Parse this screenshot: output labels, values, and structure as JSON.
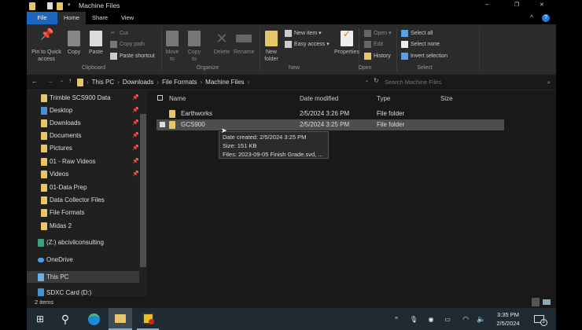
{
  "window": {
    "title": "Machine Files",
    "controls": {
      "minimize": "–",
      "maximize": "❐",
      "close": "✕"
    }
  },
  "tabs": [
    "File",
    "Home",
    "Share",
    "View"
  ],
  "ribbon": {
    "clipboard": {
      "label": "Clipboard",
      "pin": "Pin to Quick access",
      "copy": "Copy",
      "paste": "Paste",
      "cut": "Cut",
      "copy_path": "Copy path",
      "paste_shortcut": "Paste shortcut"
    },
    "organize": {
      "label": "Organize",
      "move_to": "Move to",
      "copy_to": "Copy to",
      "delete": "Delete",
      "rename": "Rename"
    },
    "new": {
      "label": "New",
      "new_folder": "New folder",
      "new_item": "New item ▾",
      "easy_access": "Easy access ▾"
    },
    "open": {
      "label": "Open",
      "properties": "Properties",
      "open": "Open ▾",
      "edit": "Edit",
      "history": "History"
    },
    "select": {
      "label": "Select",
      "select_all": "Select all",
      "select_none": "Select none",
      "invert": "Invert selection"
    }
  },
  "address": {
    "breadcrumb": [
      "This PC",
      "Downloads",
      "File Formats",
      "Machine Files"
    ],
    "search_placeholder": "Search Machine Files"
  },
  "nav": {
    "items": [
      {
        "label": "Trimble SCS900 Data",
        "pinned": true
      },
      {
        "label": "Desktop",
        "pinned": true
      },
      {
        "label": "Downloads",
        "pinned": true
      },
      {
        "label": "Documents",
        "pinned": true
      },
      {
        "label": "Pictures",
        "pinned": true
      },
      {
        "label": "01 - Raw Videos",
        "pinned": true
      },
      {
        "label": "Videos",
        "pinned": true
      },
      {
        "label": "01-Data Prep",
        "pinned": false
      },
      {
        "label": "Data Collector Files",
        "pinned": false
      },
      {
        "label": "File Formats",
        "pinned": false
      },
      {
        "label": "Midas 2",
        "pinned": false
      }
    ],
    "z_drive": "(Z:) abcivilconsulting",
    "onedrive": "OneDrive",
    "this_pc": "This PC",
    "sdxc": "SDXC Card (D:)"
  },
  "columns": {
    "name": "Name",
    "date": "Date modified",
    "type": "Type",
    "size": "Size"
  },
  "files": [
    {
      "name": "Earthworks",
      "date": "2/5/2024 3:26 PM",
      "type": "File folder"
    },
    {
      "name": "GCS900",
      "date": "2/5/2024 3:25 PM",
      "type": "File folder"
    }
  ],
  "tooltip": {
    "created": "Date created: 2/5/2024 3:25 PM",
    "size": "Size: 151 KB",
    "files": "Files: 2023-09-05 Finish Grade.svd, ..."
  },
  "status": {
    "count": "2 items"
  },
  "taskbar": {
    "time": "3:35 PM",
    "date": "2/5/2024",
    "notifications": "3"
  }
}
